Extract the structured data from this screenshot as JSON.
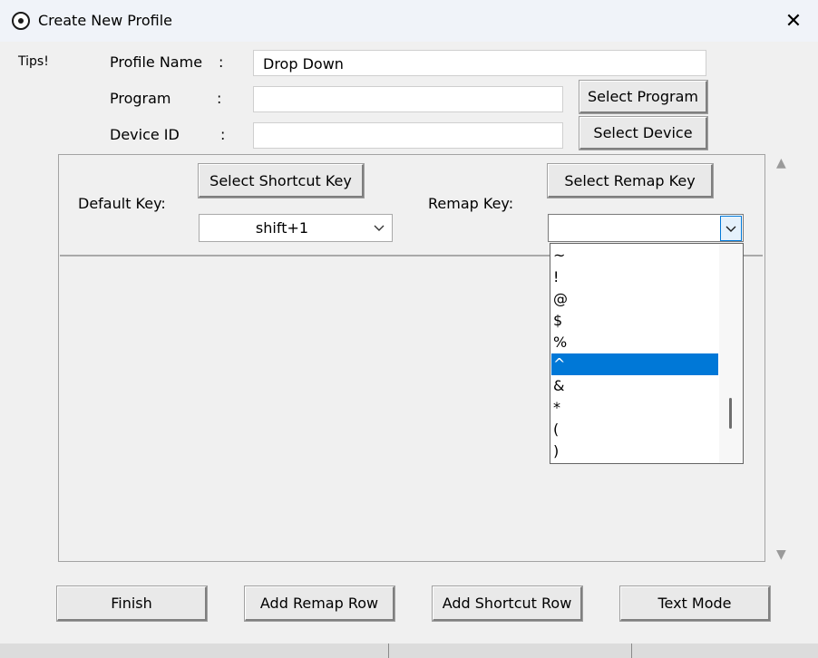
{
  "window": {
    "title": "Create New Profile",
    "close_glyph": "✕"
  },
  "tips": "Tips!",
  "form": {
    "profile_name_label": "Profile Name",
    "program_label": "Program",
    "device_id_label": "Device ID",
    "colon": ":",
    "profile_name_value": "Drop Down",
    "program_value": "",
    "device_id_value": "",
    "select_program": "Select Program",
    "select_device": "Select Device"
  },
  "mapping": {
    "default_key_label": "Default Key:",
    "remap_key_label": "Remap Key:",
    "select_shortcut_key": "Select Shortcut Key",
    "select_remap_key": "Select Remap Key",
    "default_key_value": "shift+1",
    "remap_key_value": ""
  },
  "dropdown": {
    "items": [
      "~",
      "!",
      "@",
      "$",
      "%",
      "^",
      "&",
      "*",
      "(",
      ")"
    ],
    "selected": "^"
  },
  "actions": {
    "finish": "Finish",
    "add_remap_row": "Add Remap Row",
    "add_shortcut_row": "Add Shortcut Row",
    "text_mode": "Text Mode"
  },
  "colors": {
    "selection": "#0078d7",
    "background": "#f0f0f0"
  }
}
